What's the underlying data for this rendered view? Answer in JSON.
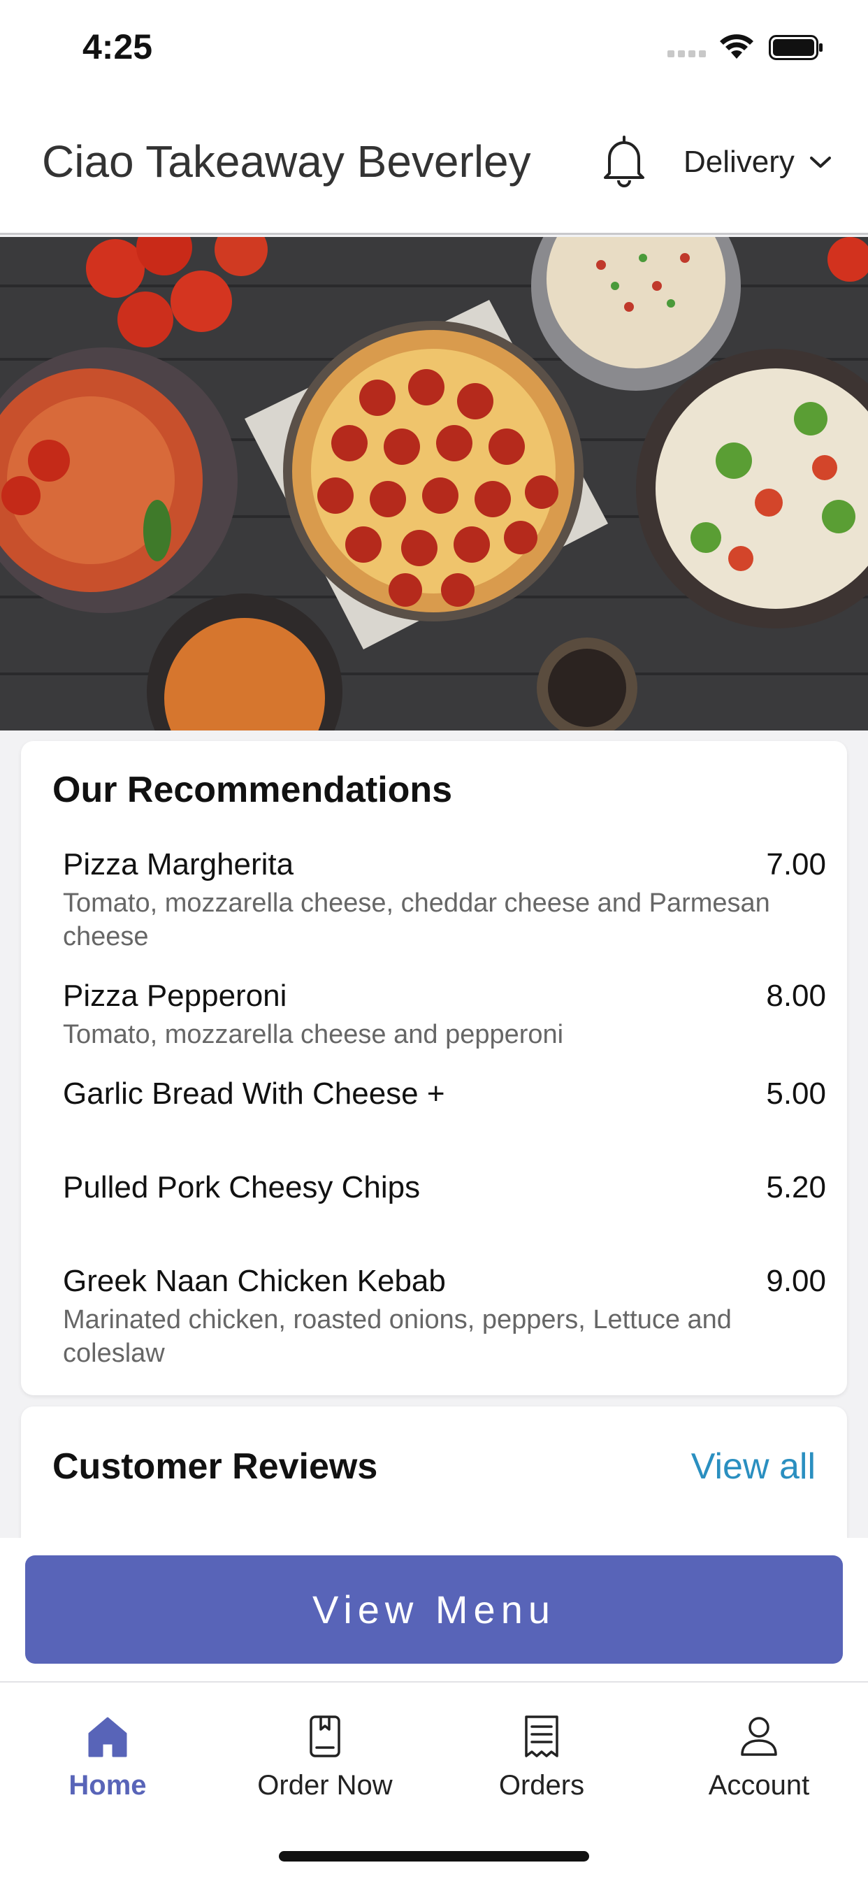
{
  "status_bar": {
    "time": "4:25"
  },
  "header": {
    "title": "Ciao Takeaway Beverley",
    "bell_icon": "bell-icon",
    "delivery_mode": "Delivery",
    "chevron_icon": "chevron-down-icon"
  },
  "recommendations": {
    "title": "Our Recommendations",
    "items": [
      {
        "name": "Pizza Margherita",
        "price": "7.00",
        "description": "Tomato, mozzarella cheese, cheddar cheese and Parmesan cheese"
      },
      {
        "name": "Pizza Pepperoni",
        "price": "8.00",
        "description": "Tomato, mozzarella cheese and pepperoni"
      },
      {
        "name": "Garlic Bread With Cheese +",
        "price": "5.00",
        "description": ""
      },
      {
        "name": "Pulled Pork Cheesy Chips",
        "price": "5.20",
        "description": ""
      },
      {
        "name": "Greek Naan Chicken Kebab",
        "price": "9.00",
        "description": "Marinated chicken, roasted onions, peppers, Lettuce and coleslaw"
      }
    ]
  },
  "reviews": {
    "title": "Customer Reviews",
    "view_all": "View all"
  },
  "cta": {
    "label": "View Menu"
  },
  "tabs": [
    {
      "label": "Home",
      "icon": "home-icon",
      "active": true
    },
    {
      "label": "Order Now",
      "icon": "menu-book-icon",
      "active": false
    },
    {
      "label": "Orders",
      "icon": "receipt-icon",
      "active": false
    },
    {
      "label": "Account",
      "icon": "person-icon",
      "active": false
    }
  ],
  "colors": {
    "accent": "#5864b8",
    "link": "#2a8fc0"
  }
}
